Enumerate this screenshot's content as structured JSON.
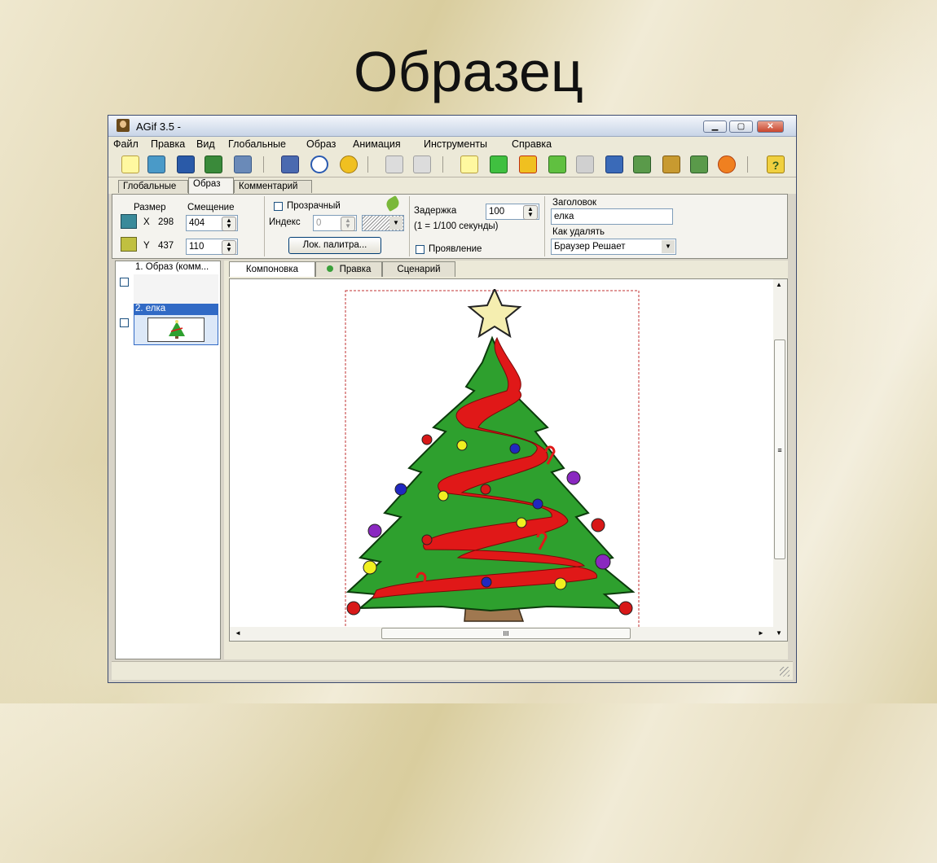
{
  "slide_title": "Образец",
  "window": {
    "title": "AGif 3.5 -",
    "controls": {
      "minimize": "▁",
      "maximize": "▢",
      "close": "✕"
    }
  },
  "menu": [
    "Файл",
    "Правка",
    "Вид",
    "Глобальные",
    "Образ",
    "Анимация",
    "Инструменты",
    "Справка"
  ],
  "toolbar_icons": [
    "new-icon",
    "open-icon",
    "export-icon",
    "save-icon",
    "save-as-icon",
    "load-icon",
    "refresh-icon",
    "smiley-icon",
    "undo-icon",
    "redo-icon",
    "add-frame-icon",
    "plus-icon",
    "delete-icon",
    "move-up-icon",
    "move-down-icon",
    "image-icon",
    "duplicate-icon",
    "film-icon",
    "optimize-icon",
    "burst-icon",
    "help-icon"
  ],
  "toolbar_help_glyph": "?",
  "tabs": {
    "global": "Глобальные",
    "image": "Образ",
    "comment": "Комментарий"
  },
  "image_panel": {
    "size_label": "Размер",
    "offset_label": "Смещение",
    "x_label": "X",
    "x_value": "298",
    "x_offset": "404",
    "y_label": "Y",
    "y_value": "437",
    "y_offset": "110",
    "transparent_label": "Прозрачный",
    "index_label": "Индекс",
    "index_value": "0",
    "local_palette_button": "Лок. палитра...",
    "delay_label": "Задержка",
    "delay_value": "100",
    "delay_hint": "(1 = 1/100 секунды)",
    "interlace_label": "Проявление",
    "caption_label": "Заголовок",
    "caption_value": "елка",
    "disposal_label": "Как удалять",
    "disposal_value": "Браузер Решает"
  },
  "frames": [
    {
      "label": "1. Образ (комм...",
      "selected": false
    },
    {
      "label": "2. елка",
      "selected": true
    }
  ],
  "subtabs": {
    "layout": "Компоновка",
    "edit": "Правка",
    "script": "Сценарий"
  },
  "scroll_glyphs": {
    "up": "▲",
    "down": "▼",
    "left": "◄",
    "right": "►",
    "grip_v": "≡",
    "grip_h": "III"
  },
  "colors": {
    "tree_green": "#2ea02e",
    "ribbon_red": "#e01818",
    "star": "#f5eeb0",
    "selection_blue": "#316ac5"
  }
}
